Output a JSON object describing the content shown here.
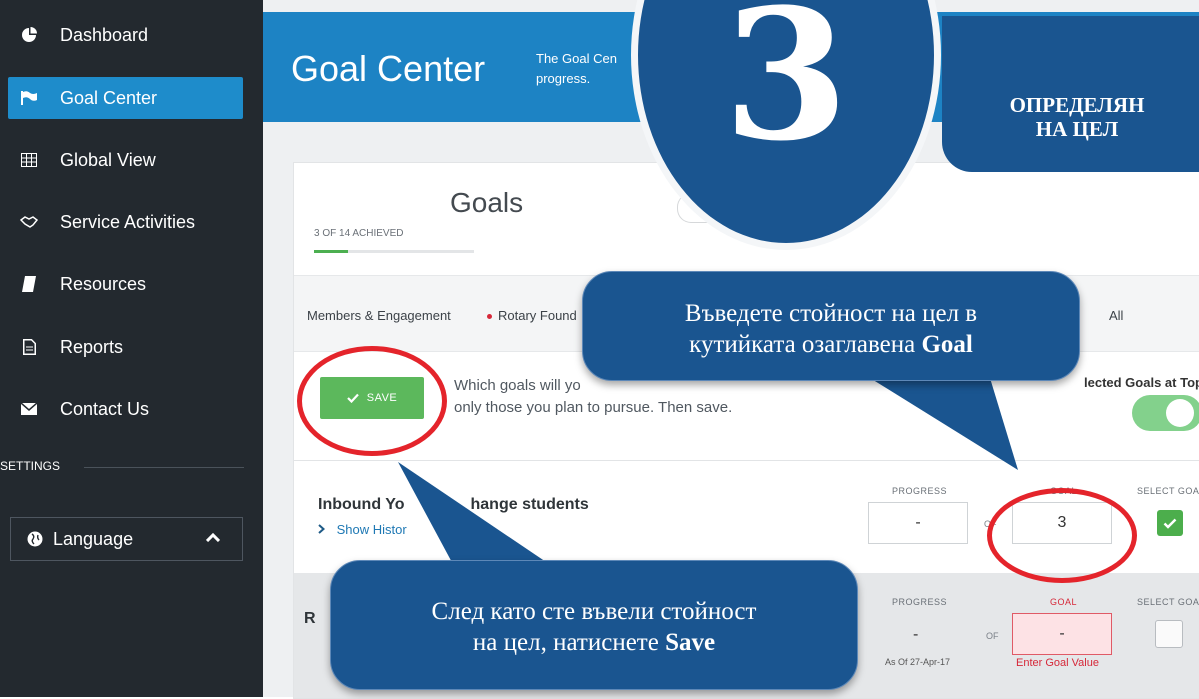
{
  "sidebar": {
    "items": [
      {
        "label": "Dashboard",
        "icon": "pie-chart-icon"
      },
      {
        "label": "Goal Center",
        "icon": "flag-icon",
        "active": true
      },
      {
        "label": "Global View",
        "icon": "grid-icon"
      },
      {
        "label": "Service Activities",
        "icon": "handshake-icon"
      },
      {
        "label": "Resources",
        "icon": "book-icon"
      },
      {
        "label": "Reports",
        "icon": "document-icon"
      },
      {
        "label": "Contact Us",
        "icon": "envelope-icon"
      }
    ],
    "settings_label": "SETTINGS",
    "language_label": "Language"
  },
  "header": {
    "title": "Goal Center",
    "description_line1": "The Goal Cen",
    "description_line2": "progress."
  },
  "card": {
    "title": "Goals",
    "achieved_text": "3 OF 14 ACHIEVED",
    "achieved_fraction": 0.214,
    "tabs": [
      {
        "label": "Members & Engagement"
      },
      {
        "label": "Rotary Found"
      },
      {
        "label": "All"
      }
    ],
    "save_label": "SAVE",
    "instruction_line1": "Which goals will yo",
    "instruction_line2": "only those you plan to pursue. Then save.",
    "selected_top_label": "lected Goals at Top",
    "rows": [
      {
        "title_part1": "Inbound Yo",
        "title_part2": "hange students",
        "show_history": "Show Histor",
        "progress_label": "PROGRESS",
        "progress_value": "-",
        "of_label": "OF",
        "goal_label": "GOAL",
        "goal_value": "3",
        "select_label": "SELECT GOAL"
      },
      {
        "title_fragment": "R",
        "progress_label": "PROGRESS",
        "progress_value": "-",
        "as_of": "As Of 27-Apr-17",
        "of_label": "OF",
        "goal_label": "GOAL",
        "goal_value": "-",
        "goal_error": "Enter Goal Value",
        "select_label": "SELECT GOAL"
      }
    ]
  },
  "overlay": {
    "step_number": "3",
    "banner_line1": "ОПРЕДЕЛЯН",
    "banner_line2": "НА ЦЕЛ",
    "bubble1_line1": "Въведете стойност на цел в",
    "bubble1_line2": "кутийката озаглавена ",
    "bubble1_bold": "Goal",
    "bubble2_line1": "След като сте въвели стойност",
    "bubble2_line2": "на цел, натиснете ",
    "bubble2_bold": "Save"
  },
  "colors": {
    "sidebar_bg": "#23292f",
    "active_nav": "#1e8ccb",
    "header_bg": "#1d83c4",
    "save_green": "#5cb85c",
    "overlay_blue": "#1a5590",
    "highlight_red": "#e4242b",
    "error_red": "#d62839"
  }
}
